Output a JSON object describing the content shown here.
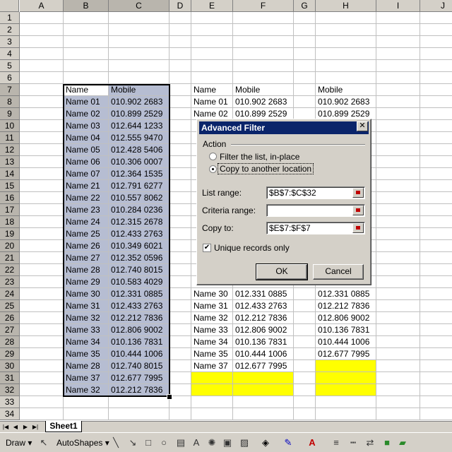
{
  "columns": [
    "A",
    "B",
    "C",
    "D",
    "E",
    "F",
    "G",
    "H",
    "I",
    "J"
  ],
  "rows": [
    "1",
    "2",
    "3",
    "4",
    "5",
    "6",
    "7",
    "8",
    "9",
    "10",
    "11",
    "12",
    "13",
    "14",
    "15",
    "16",
    "17",
    "18",
    "19",
    "20",
    "21",
    "22",
    "23",
    "24",
    "25",
    "26",
    "27",
    "28",
    "29",
    "30",
    "31",
    "32",
    "33",
    "34"
  ],
  "cells": [
    {
      "ref": "B7",
      "v": "Name"
    },
    {
      "ref": "C7",
      "v": "Mobile"
    },
    {
      "ref": "B8",
      "v": "Name 01"
    },
    {
      "ref": "C8",
      "v": "010.902 2683"
    },
    {
      "ref": "B9",
      "v": "Name 02"
    },
    {
      "ref": "C9",
      "v": "010.899 2529"
    },
    {
      "ref": "B10",
      "v": "Name 03"
    },
    {
      "ref": "C10",
      "v": "012.644 1233"
    },
    {
      "ref": "B11",
      "v": "Name 04"
    },
    {
      "ref": "C11",
      "v": "012.555 9470"
    },
    {
      "ref": "B12",
      "v": "Name 05"
    },
    {
      "ref": "C12",
      "v": "012.428 5406"
    },
    {
      "ref": "B13",
      "v": "Name 06"
    },
    {
      "ref": "C13",
      "v": "010.306 0007"
    },
    {
      "ref": "B14",
      "v": "Name 07"
    },
    {
      "ref": "C14",
      "v": "012.364 1535"
    },
    {
      "ref": "B15",
      "v": "Name 21"
    },
    {
      "ref": "C15",
      "v": "012.791 6277"
    },
    {
      "ref": "B16",
      "v": "Name 22"
    },
    {
      "ref": "C16",
      "v": "010.557 8062"
    },
    {
      "ref": "B17",
      "v": "Name 23"
    },
    {
      "ref": "C17",
      "v": "010.284 0236"
    },
    {
      "ref": "B18",
      "v": "Name 24"
    },
    {
      "ref": "C18",
      "v": "012.315 2678"
    },
    {
      "ref": "B19",
      "v": "Name 25"
    },
    {
      "ref": "C19",
      "v": "012.433 2763"
    },
    {
      "ref": "B20",
      "v": "Name 26"
    },
    {
      "ref": "C20",
      "v": "010.349 6021"
    },
    {
      "ref": "B21",
      "v": "Name 27"
    },
    {
      "ref": "C21",
      "v": "012.352 0596"
    },
    {
      "ref": "B22",
      "v": "Name 28"
    },
    {
      "ref": "C22",
      "v": "012.740 8015"
    },
    {
      "ref": "B23",
      "v": "Name 29"
    },
    {
      "ref": "C23",
      "v": "010.583 4029"
    },
    {
      "ref": "B24",
      "v": "Name 30"
    },
    {
      "ref": "C24",
      "v": "012.331 0885"
    },
    {
      "ref": "B25",
      "v": "Name 31"
    },
    {
      "ref": "C25",
      "v": "012.433 2763"
    },
    {
      "ref": "B26",
      "v": "Name 32"
    },
    {
      "ref": "C26",
      "v": "012.212 7836"
    },
    {
      "ref": "B27",
      "v": "Name 33"
    },
    {
      "ref": "C27",
      "v": "012.806 9002"
    },
    {
      "ref": "B28",
      "v": "Name 34"
    },
    {
      "ref": "C28",
      "v": "010.136 7831"
    },
    {
      "ref": "B29",
      "v": "Name 35"
    },
    {
      "ref": "C29",
      "v": "010.444 1006"
    },
    {
      "ref": "B30",
      "v": "Name 28"
    },
    {
      "ref": "C30",
      "v": "012.740 8015"
    },
    {
      "ref": "B31",
      "v": "Name 37"
    },
    {
      "ref": "C31",
      "v": "012.677 7995"
    },
    {
      "ref": "B32",
      "v": "Name 32"
    },
    {
      "ref": "C32",
      "v": "012.212 7836"
    },
    {
      "ref": "E7",
      "v": "Name"
    },
    {
      "ref": "F7",
      "v": "Mobile"
    },
    {
      "ref": "E8",
      "v": "Name 01"
    },
    {
      "ref": "F8",
      "v": "010.902 2683"
    },
    {
      "ref": "E9",
      "v": "Name 02"
    },
    {
      "ref": "F9",
      "v": "010.899 2529"
    },
    {
      "ref": "E24",
      "v": "Name 30"
    },
    {
      "ref": "F24",
      "v": "012.331 0885"
    },
    {
      "ref": "E25",
      "v": "Name 31"
    },
    {
      "ref": "F25",
      "v": "012.433 2763"
    },
    {
      "ref": "E26",
      "v": "Name 32"
    },
    {
      "ref": "F26",
      "v": "012.212 7836"
    },
    {
      "ref": "E27",
      "v": "Name 33"
    },
    {
      "ref": "F27",
      "v": "012.806 9002"
    },
    {
      "ref": "E28",
      "v": "Name 34"
    },
    {
      "ref": "F28",
      "v": "010.136 7831"
    },
    {
      "ref": "E29",
      "v": "Name 35"
    },
    {
      "ref": "F29",
      "v": "010.444 1006"
    },
    {
      "ref": "E30",
      "v": "Name 37"
    },
    {
      "ref": "F30",
      "v": "012.677 7995"
    },
    {
      "ref": "H7",
      "v": "Mobile"
    },
    {
      "ref": "H8",
      "v": "010.902 2683"
    },
    {
      "ref": "H9",
      "v": "010.899 2529"
    },
    {
      "ref": "H24",
      "v": "012.331 0885"
    },
    {
      "ref": "H25",
      "v": "012.212 7836"
    },
    {
      "ref": "H26",
      "v": "012.806 9002"
    },
    {
      "ref": "H27",
      "v": "010.136 7831"
    },
    {
      "ref": "H28",
      "v": "010.444 1006"
    },
    {
      "ref": "H29",
      "v": "012.677 7995"
    }
  ],
  "selected_range": "B7:C32",
  "yellow_cells": [
    "E31",
    "F31",
    "E32",
    "F32",
    "H30",
    "H31",
    "H32"
  ],
  "colors": {
    "selection": "#b6bdd2",
    "highlight": "#ffff00",
    "title_bar": "#0a246a",
    "face": "#d4d0c8"
  },
  "dialog": {
    "title": "Advanced Filter",
    "close_glyph": "✕",
    "action_label": "Action",
    "option_filter": "Filter the list, in-place",
    "option_copy": "Copy to another location",
    "selected_option": "copy",
    "list_range_label": "List range:",
    "list_range_value": "$B$7:$C$32",
    "criteria_range_label": "Criteria range:",
    "criteria_range_value": "",
    "copy_to_label": "Copy to:",
    "copy_to_value": "$E$7:$F$7",
    "unique_label": "Unique records only",
    "unique_checked": true,
    "ok": "OK",
    "cancel": "Cancel"
  },
  "sheet_tab": "Sheet1",
  "draw_toolbar": {
    "draw": "Draw ▾",
    "autoshapes": "AutoShapes ▾"
  }
}
